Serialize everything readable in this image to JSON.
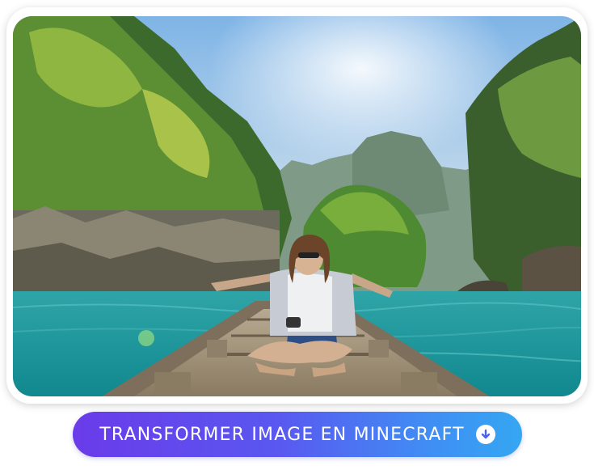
{
  "photo": {
    "description_icon": "landscape-photo"
  },
  "cta": {
    "label": "TRANSFORMER IMAGE EN MINECRAFT",
    "icon": "arrow-down-circle-icon",
    "gradient_start": "#6a3bea",
    "gradient_end": "#35a7f2"
  }
}
